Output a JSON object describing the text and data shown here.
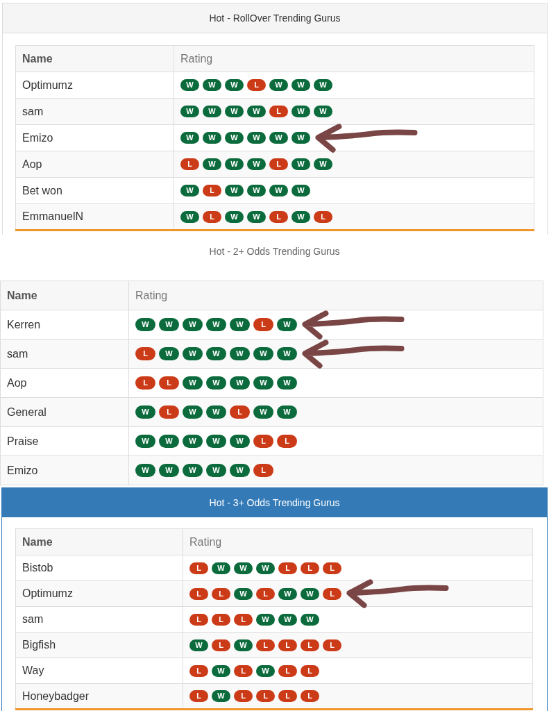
{
  "panels": [
    {
      "title": "Hot - RollOver Trending Gurus",
      "kind": "grey",
      "columns": [
        "Name",
        "Rating"
      ],
      "rows": [
        {
          "name": "Optimumz",
          "marked": false,
          "results": [
            {
              "text": "W",
              "kind": "win"
            },
            {
              "text": "W",
              "kind": "win"
            },
            {
              "text": "W",
              "kind": "win"
            },
            {
              "text": "L",
              "kind": "loss"
            },
            {
              "text": "W",
              "kind": "win"
            },
            {
              "text": "W",
              "kind": "win"
            },
            {
              "text": "W",
              "kind": "win"
            }
          ]
        },
        {
          "name": "sam",
          "marked": false,
          "results": [
            {
              "text": "W",
              "kind": "win"
            },
            {
              "text": "W",
              "kind": "win"
            },
            {
              "text": "W",
              "kind": "win"
            },
            {
              "text": "W",
              "kind": "win"
            },
            {
              "text": "L",
              "kind": "loss"
            },
            {
              "text": "W",
              "kind": "win"
            },
            {
              "text": "W",
              "kind": "win"
            }
          ]
        },
        {
          "name": "Emizo",
          "marked": true,
          "results": [
            {
              "text": "W",
              "kind": "win"
            },
            {
              "text": "W",
              "kind": "win"
            },
            {
              "text": "W",
              "kind": "win"
            },
            {
              "text": "W",
              "kind": "win"
            },
            {
              "text": "W",
              "kind": "win"
            },
            {
              "text": "W",
              "kind": "win"
            }
          ]
        },
        {
          "name": "Aop",
          "marked": false,
          "results": [
            {
              "text": "L",
              "kind": "loss"
            },
            {
              "text": "W",
              "kind": "win"
            },
            {
              "text": "W",
              "kind": "win"
            },
            {
              "text": "W",
              "kind": "win"
            },
            {
              "text": "L",
              "kind": "loss"
            },
            {
              "text": "W",
              "kind": "win"
            },
            {
              "text": "W",
              "kind": "win"
            }
          ]
        },
        {
          "name": "Bet won",
          "marked": false,
          "results": [
            {
              "text": "W",
              "kind": "win"
            },
            {
              "text": "L",
              "kind": "loss"
            },
            {
              "text": "W",
              "kind": "win"
            },
            {
              "text": "W",
              "kind": "win"
            },
            {
              "text": "W",
              "kind": "win"
            },
            {
              "text": "W",
              "kind": "win"
            }
          ]
        },
        {
          "name": "EmmanuelN",
          "marked": false,
          "results": [
            {
              "text": "W",
              "kind": "win"
            },
            {
              "text": "L",
              "kind": "loss"
            },
            {
              "text": "W",
              "kind": "win"
            },
            {
              "text": "W",
              "kind": "win"
            },
            {
              "text": "L",
              "kind": "loss"
            },
            {
              "text": "W",
              "kind": "win"
            },
            {
              "text": "L",
              "kind": "loss"
            }
          ]
        }
      ]
    },
    {
      "title": "Hot - 2+ Odds Trending Gurus",
      "kind": "plain",
      "columns": [
        "Name",
        "Rating"
      ],
      "rows": [
        {
          "name": "Kerren",
          "marked": true,
          "results": [
            {
              "text": "W",
              "kind": "win"
            },
            {
              "text": "W",
              "kind": "win"
            },
            {
              "text": "W",
              "kind": "win"
            },
            {
              "text": "W",
              "kind": "win"
            },
            {
              "text": "W",
              "kind": "win"
            },
            {
              "text": "L",
              "kind": "loss"
            },
            {
              "text": "W",
              "kind": "win"
            }
          ]
        },
        {
          "name": "sam",
          "marked": true,
          "results": [
            {
              "text": "L",
              "kind": "loss"
            },
            {
              "text": "W",
              "kind": "win"
            },
            {
              "text": "W",
              "kind": "win"
            },
            {
              "text": "W",
              "kind": "win"
            },
            {
              "text": "W",
              "kind": "win"
            },
            {
              "text": "W",
              "kind": "win"
            },
            {
              "text": "W",
              "kind": "win"
            }
          ]
        },
        {
          "name": "Aop",
          "marked": false,
          "results": [
            {
              "text": "L",
              "kind": "loss"
            },
            {
              "text": "L",
              "kind": "loss"
            },
            {
              "text": "W",
              "kind": "win"
            },
            {
              "text": "W",
              "kind": "win"
            },
            {
              "text": "W",
              "kind": "win"
            },
            {
              "text": "W",
              "kind": "win"
            },
            {
              "text": "W",
              "kind": "win"
            }
          ]
        },
        {
          "name": "General",
          "marked": false,
          "results": [
            {
              "text": "W",
              "kind": "win"
            },
            {
              "text": "L",
              "kind": "loss"
            },
            {
              "text": "W",
              "kind": "win"
            },
            {
              "text": "W",
              "kind": "win"
            },
            {
              "text": "L",
              "kind": "loss"
            },
            {
              "text": "W",
              "kind": "win"
            },
            {
              "text": "W",
              "kind": "win"
            }
          ]
        },
        {
          "name": "Praise",
          "marked": false,
          "results": [
            {
              "text": "W",
              "kind": "win"
            },
            {
              "text": "W",
              "kind": "win"
            },
            {
              "text": "W",
              "kind": "win"
            },
            {
              "text": "W",
              "kind": "win"
            },
            {
              "text": "W",
              "kind": "win"
            },
            {
              "text": "L",
              "kind": "loss"
            },
            {
              "text": "L",
              "kind": "loss"
            }
          ]
        },
        {
          "name": "Emizo",
          "marked": false,
          "results": [
            {
              "text": "W",
              "kind": "win"
            },
            {
              "text": "W",
              "kind": "win"
            },
            {
              "text": "W",
              "kind": "win"
            },
            {
              "text": "W",
              "kind": "win"
            },
            {
              "text": "W",
              "kind": "win"
            },
            {
              "text": "L",
              "kind": "loss"
            }
          ]
        }
      ]
    },
    {
      "title": "Hot - 3+ Odds Trending Gurus",
      "kind": "blue",
      "columns": [
        "Name",
        "Rating"
      ],
      "rows": [
        {
          "name": "Bistob",
          "marked": false,
          "results": [
            {
              "text": "L",
              "kind": "loss"
            },
            {
              "text": "W",
              "kind": "win"
            },
            {
              "text": "W",
              "kind": "win"
            },
            {
              "text": "W",
              "kind": "win"
            },
            {
              "text": "L",
              "kind": "loss"
            },
            {
              "text": "L",
              "kind": "loss"
            },
            {
              "text": "L",
              "kind": "loss"
            }
          ]
        },
        {
          "name": "Optimumz",
          "marked": true,
          "results": [
            {
              "text": "L",
              "kind": "loss"
            },
            {
              "text": "L",
              "kind": "loss"
            },
            {
              "text": "W",
              "kind": "win"
            },
            {
              "text": "L",
              "kind": "loss"
            },
            {
              "text": "W",
              "kind": "win"
            },
            {
              "text": "W",
              "kind": "win"
            },
            {
              "text": "L",
              "kind": "loss"
            }
          ]
        },
        {
          "name": "sam",
          "marked": false,
          "results": [
            {
              "text": "L",
              "kind": "loss"
            },
            {
              "text": "L",
              "kind": "loss"
            },
            {
              "text": "L",
              "kind": "loss"
            },
            {
              "text": "W",
              "kind": "win"
            },
            {
              "text": "W",
              "kind": "win"
            },
            {
              "text": "W",
              "kind": "win"
            }
          ]
        },
        {
          "name": "Bigfish",
          "marked": false,
          "results": [
            {
              "text": "W",
              "kind": "win"
            },
            {
              "text": "L",
              "kind": "loss"
            },
            {
              "text": "W",
              "kind": "win"
            },
            {
              "text": "L",
              "kind": "loss"
            },
            {
              "text": "L",
              "kind": "loss"
            },
            {
              "text": "L",
              "kind": "loss"
            },
            {
              "text": "L",
              "kind": "loss"
            }
          ]
        },
        {
          "name": "Way",
          "marked": false,
          "results": [
            {
              "text": "L",
              "kind": "loss"
            },
            {
              "text": "W",
              "kind": "win"
            },
            {
              "text": "L",
              "kind": "loss"
            },
            {
              "text": "W",
              "kind": "win"
            },
            {
              "text": "L",
              "kind": "loss"
            },
            {
              "text": "L",
              "kind": "loss"
            }
          ]
        },
        {
          "name": "Honeybadger",
          "marked": false,
          "results": [
            {
              "text": "L",
              "kind": "loss"
            },
            {
              "text": "W",
              "kind": "win"
            },
            {
              "text": "L",
              "kind": "loss"
            },
            {
              "text": "L",
              "kind": "loss"
            },
            {
              "text": "L",
              "kind": "loss"
            },
            {
              "text": "L",
              "kind": "loss"
            }
          ]
        }
      ]
    }
  ]
}
